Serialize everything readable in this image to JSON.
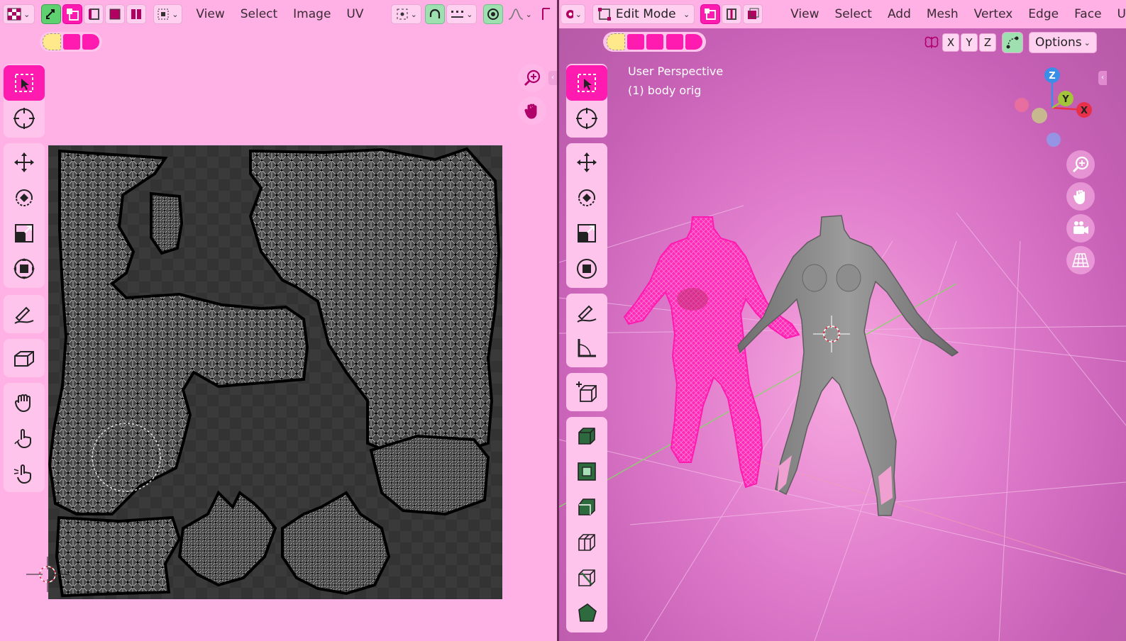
{
  "uv_header": {
    "menus": [
      "View",
      "Select",
      "Image",
      "UV"
    ]
  },
  "vp_header": {
    "mode": "Edit Mode",
    "menus": [
      "View",
      "Select",
      "Add",
      "Mesh",
      "Vertex",
      "Edge",
      "Face",
      "U"
    ]
  },
  "viewport": {
    "perspective_label": "User Perspective",
    "object_label": "(1) body orig",
    "axis_x": "X",
    "axis_y": "Y",
    "axis_z": "Z",
    "mirror_x": "X",
    "mirror_y": "Y",
    "mirror_z": "Z",
    "options_label": "Options"
  },
  "colors": {
    "accent": "#ff1ab0",
    "header_bg": "#ffb0e4",
    "axis_x": "#e8304a",
    "axis_y": "#a4c43a",
    "axis_z": "#3a8ee8"
  }
}
